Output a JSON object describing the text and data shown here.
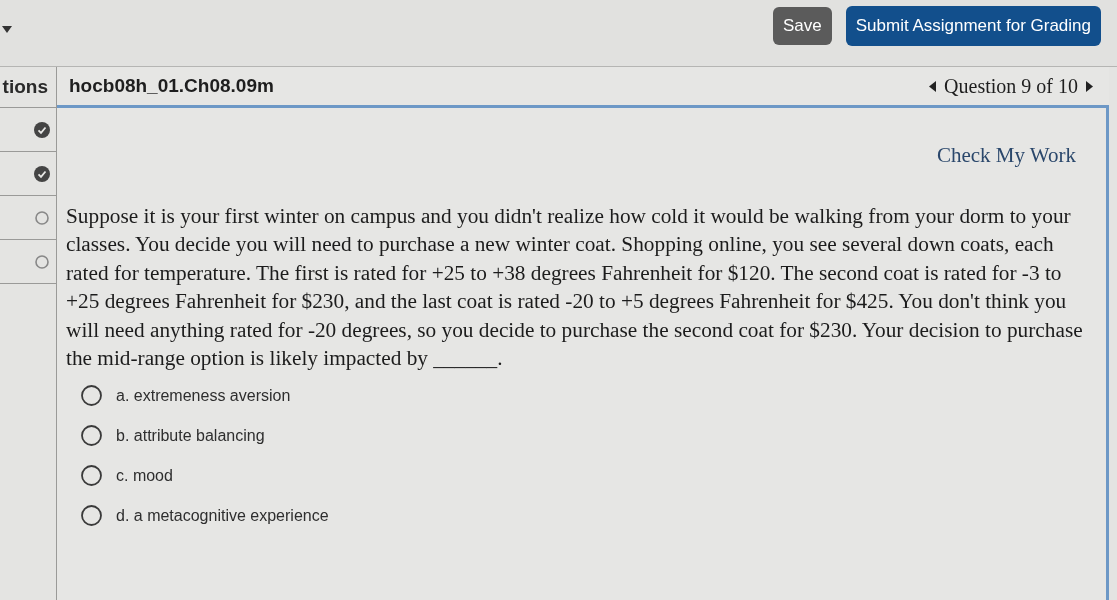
{
  "toolbar": {
    "buttons": [
      {
        "label": "Save",
        "kind": "secondary"
      },
      {
        "label": "Submit Assignment for Grading",
        "kind": "primary"
      }
    ]
  },
  "sidebar": {
    "header": "tions",
    "items": [
      {
        "answered": true
      },
      {
        "answered": true
      },
      {
        "answered": false
      },
      {
        "answered": false
      }
    ]
  },
  "assignment": {
    "title": "hocb08h_01.Ch08.09m",
    "navigation": "Question 9 of 10"
  },
  "check_my_work": "Check My Work",
  "question": {
    "text": "Suppose it is your first winter on campus and you didn't realize how cold it would be walking from your dorm to your classes. You decide you will need to purchase a new winter coat. Shopping online, you see several down coats, each rated for temperature. The first is rated for +25 to +38 degrees Fahrenheit for $120. The second coat is rated for -3 to +25 degrees Fahrenheit for $230, and the last coat is rated -20 to +5 degrees Fahrenheit for $425. You don't think you will need anything rated for -20 degrees, so you decide to purchase the second coat for $230. Your decision to purchase the mid-range option is likely impacted by ______.",
    "options": [
      {
        "label": "a. extremeness aversion",
        "selected": false
      },
      {
        "label": "b. attribute balancing",
        "selected": false
      },
      {
        "label": "c. mood",
        "selected": false
      },
      {
        "label": "d. a metacognitive experience",
        "selected": false
      }
    ]
  }
}
